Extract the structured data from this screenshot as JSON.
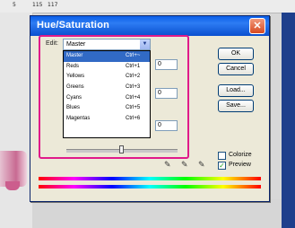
{
  "ruler": {
    "labels": [
      "5",
      "115",
      "117"
    ]
  },
  "dialog": {
    "title": "Hue/Saturation",
    "close_glyph": "✕",
    "edit_label": "Edit:",
    "edit_value": "Master",
    "dropdown_items": [
      {
        "label": "Master",
        "shortcut": "Ctrl+~"
      },
      {
        "label": "Reds",
        "shortcut": "Ctrl+1"
      },
      {
        "label": "Yellows",
        "shortcut": "Ctrl+2"
      },
      {
        "label": "Greens",
        "shortcut": "Ctrl+3"
      },
      {
        "label": "Cyans",
        "shortcut": "Ctrl+4"
      },
      {
        "label": "Blues",
        "shortcut": "Ctrl+5"
      },
      {
        "label": "Magentas",
        "shortcut": "Ctrl+6"
      }
    ],
    "hue_value": "0",
    "saturation_value": "0",
    "lightness_value": "0",
    "buttons": {
      "ok": "OK",
      "cancel": "Cancel",
      "load": "Load...",
      "save": "Save..."
    },
    "colorize_label": "Colorize",
    "colorize_checked": false,
    "preview_label": "Preview",
    "preview_checked": true,
    "check_glyph": "✓"
  },
  "colors": {
    "highlight": "#e01a8a",
    "titlebar": "#0a5ee8",
    "selected_item": "#316ac5"
  }
}
